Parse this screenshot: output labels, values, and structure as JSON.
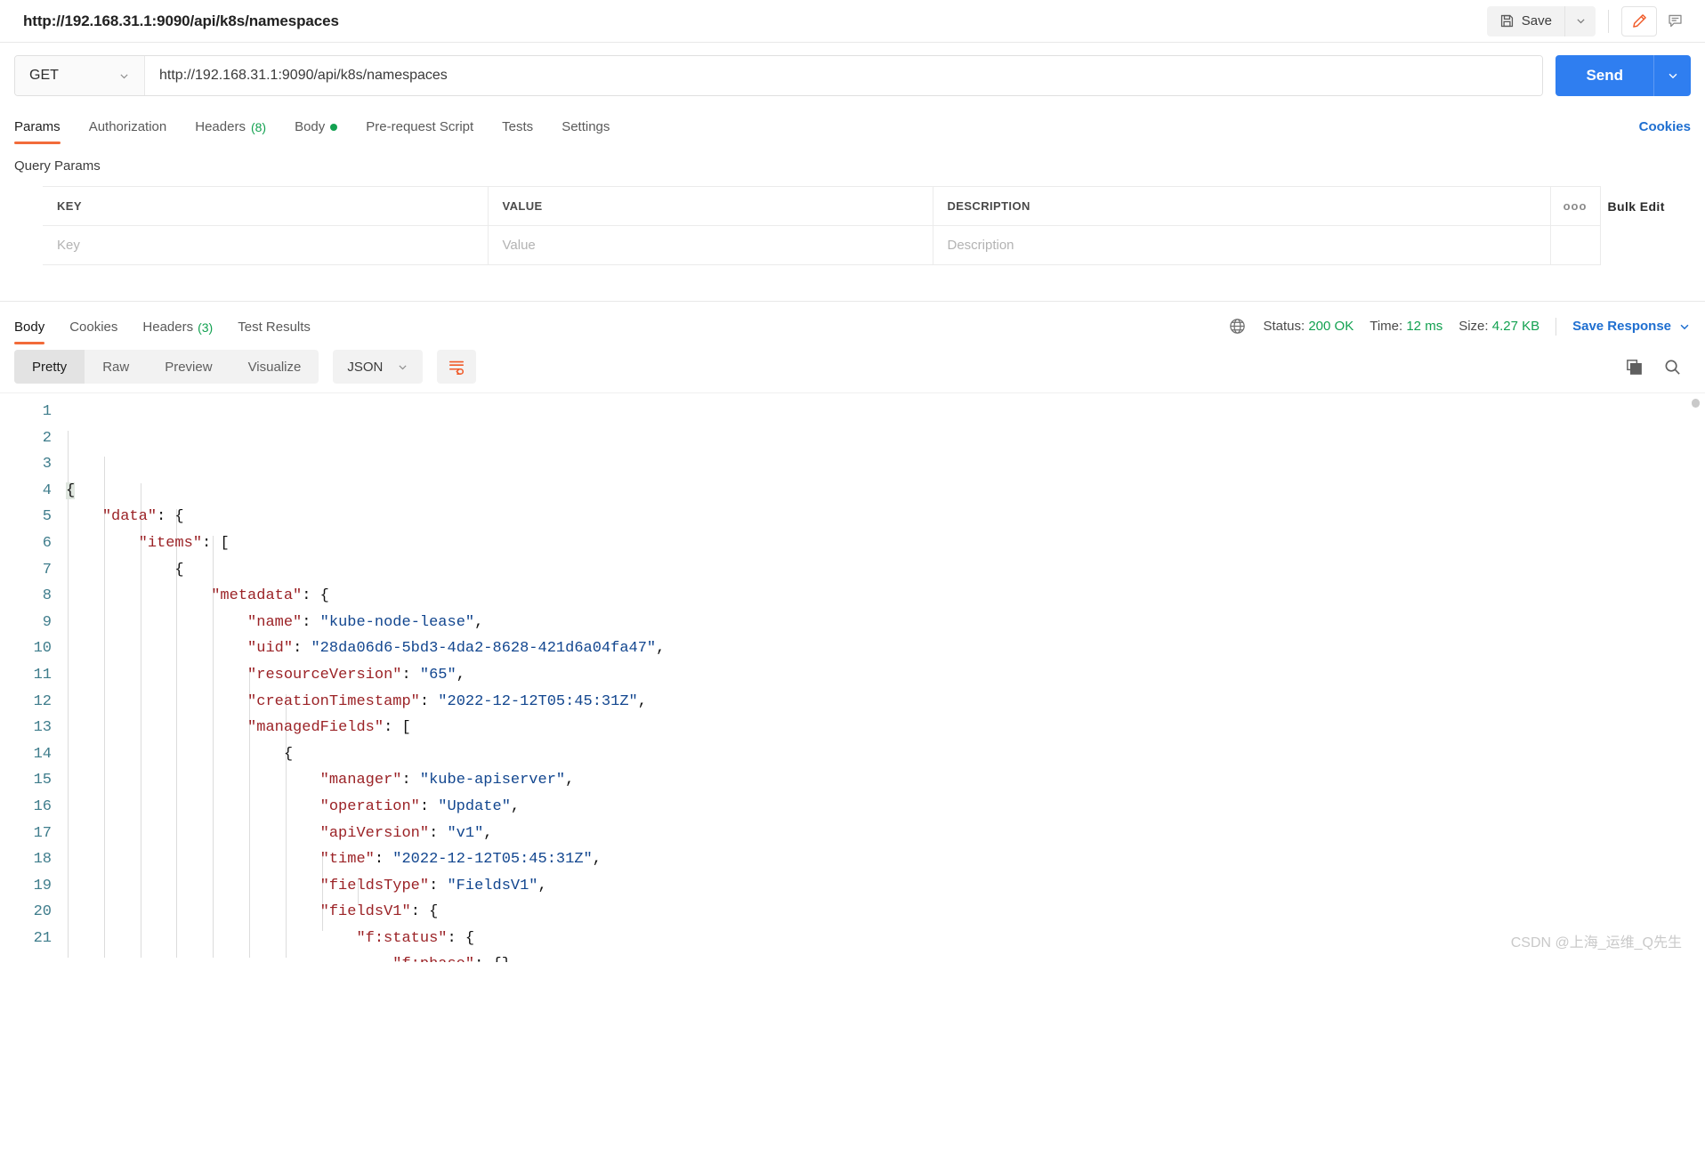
{
  "topbar": {
    "request_title": "http://192.168.31.1:9090/api/k8s/namespaces",
    "save_label": "Save",
    "save_icon": "floppy-disk-icon",
    "save_caret_icon": "chevron-down-icon",
    "edit_icon": "pencil-icon",
    "comment_icon": "comment-icon",
    "accent_color": "#f26b3a"
  },
  "url_row": {
    "method": "GET",
    "method_caret_icon": "chevron-down-icon",
    "url": "http://192.168.31.1:9090/api/k8s/namespaces",
    "send_label": "Send",
    "send_caret_icon": "chevron-down-icon",
    "send_color": "#2f7ef0"
  },
  "request_tabs": {
    "items": [
      {
        "label": "Params",
        "active": true,
        "count": "",
        "dot": false
      },
      {
        "label": "Authorization",
        "active": false,
        "count": "",
        "dot": false
      },
      {
        "label": "Headers",
        "active": false,
        "count": "(8)",
        "dot": false
      },
      {
        "label": "Body",
        "active": false,
        "count": "",
        "dot": true
      },
      {
        "label": "Pre-request Script",
        "active": false,
        "count": "",
        "dot": false
      },
      {
        "label": "Tests",
        "active": false,
        "count": "",
        "dot": false
      },
      {
        "label": "Settings",
        "active": false,
        "count": "",
        "dot": false
      }
    ],
    "cookies_label": "Cookies"
  },
  "query_params": {
    "section_label": "Query Params",
    "headers": [
      "KEY",
      "VALUE",
      "DESCRIPTION"
    ],
    "more_icon": "ellipsis-icon",
    "more_glyph": "ooo",
    "bulk_edit_label": "Bulk Edit",
    "row_placeholders": [
      "Key",
      "Value",
      "Description"
    ]
  },
  "response": {
    "tabs": [
      {
        "label": "Body",
        "active": true,
        "count": ""
      },
      {
        "label": "Cookies",
        "active": false,
        "count": ""
      },
      {
        "label": "Headers",
        "active": false,
        "count": "(3)"
      },
      {
        "label": "Test Results",
        "active": false,
        "count": ""
      }
    ],
    "globe_icon": "globe-icon",
    "status_label": "Status:",
    "status_value": "200 OK",
    "time_label": "Time:",
    "time_value": "12 ms",
    "size_label": "Size:",
    "size_value": "4.27 KB",
    "save_response_label": "Save Response",
    "save_response_caret_icon": "chevron-down-icon"
  },
  "format_bar": {
    "views": [
      {
        "label": "Pretty",
        "active": true
      },
      {
        "label": "Raw",
        "active": false
      },
      {
        "label": "Preview",
        "active": false
      },
      {
        "label": "Visualize",
        "active": false
      }
    ],
    "language": "JSON",
    "language_caret_icon": "chevron-down-icon",
    "wrap_icon": "wrap-lines-icon",
    "copy_icon": "copy-icon",
    "search_icon": "search-icon"
  },
  "code": {
    "language": "json",
    "first_line": 1,
    "last_visible_line": 21,
    "lines": [
      {
        "n": 1,
        "indent": 0,
        "segs": [
          [
            "p",
            "{"
          ]
        ],
        "highlight_brace": true
      },
      {
        "n": 2,
        "indent": 1,
        "segs": [
          [
            "k",
            "\"data\""
          ],
          [
            "p",
            ": {"
          ]
        ]
      },
      {
        "n": 3,
        "indent": 2,
        "segs": [
          [
            "k",
            "\"items\""
          ],
          [
            "p",
            ": ["
          ]
        ]
      },
      {
        "n": 4,
        "indent": 3,
        "segs": [
          [
            "p",
            "{"
          ]
        ]
      },
      {
        "n": 5,
        "indent": 4,
        "segs": [
          [
            "k",
            "\"metadata\""
          ],
          [
            "p",
            ": {"
          ]
        ]
      },
      {
        "n": 6,
        "indent": 5,
        "segs": [
          [
            "k",
            "\"name\""
          ],
          [
            "p",
            ": "
          ],
          [
            "s",
            "\"kube-node-lease\""
          ],
          [
            "p",
            ","
          ]
        ]
      },
      {
        "n": 7,
        "indent": 5,
        "segs": [
          [
            "k",
            "\"uid\""
          ],
          [
            "p",
            ": "
          ],
          [
            "s",
            "\"28da06d6-5bd3-4da2-8628-421d6a04fa47\""
          ],
          [
            "p",
            ","
          ]
        ]
      },
      {
        "n": 8,
        "indent": 5,
        "segs": [
          [
            "k",
            "\"resourceVersion\""
          ],
          [
            "p",
            ": "
          ],
          [
            "s",
            "\"65\""
          ],
          [
            "p",
            ","
          ]
        ]
      },
      {
        "n": 9,
        "indent": 5,
        "segs": [
          [
            "k",
            "\"creationTimestamp\""
          ],
          [
            "p",
            ": "
          ],
          [
            "s",
            "\"2022-12-12T05:45:31Z\""
          ],
          [
            "p",
            ","
          ]
        ]
      },
      {
        "n": 10,
        "indent": 5,
        "segs": [
          [
            "k",
            "\"managedFields\""
          ],
          [
            "p",
            ": ["
          ]
        ]
      },
      {
        "n": 11,
        "indent": 6,
        "segs": [
          [
            "p",
            "{"
          ]
        ]
      },
      {
        "n": 12,
        "indent": 7,
        "segs": [
          [
            "k",
            "\"manager\""
          ],
          [
            "p",
            ": "
          ],
          [
            "s",
            "\"kube-apiserver\""
          ],
          [
            "p",
            ","
          ]
        ]
      },
      {
        "n": 13,
        "indent": 7,
        "segs": [
          [
            "k",
            "\"operation\""
          ],
          [
            "p",
            ": "
          ],
          [
            "s",
            "\"Update\""
          ],
          [
            "p",
            ","
          ]
        ]
      },
      {
        "n": 14,
        "indent": 7,
        "segs": [
          [
            "k",
            "\"apiVersion\""
          ],
          [
            "p",
            ": "
          ],
          [
            "s",
            "\"v1\""
          ],
          [
            "p",
            ","
          ]
        ]
      },
      {
        "n": 15,
        "indent": 7,
        "segs": [
          [
            "k",
            "\"time\""
          ],
          [
            "p",
            ": "
          ],
          [
            "s",
            "\"2022-12-12T05:45:31Z\""
          ],
          [
            "p",
            ","
          ]
        ]
      },
      {
        "n": 16,
        "indent": 7,
        "segs": [
          [
            "k",
            "\"fieldsType\""
          ],
          [
            "p",
            ": "
          ],
          [
            "s",
            "\"FieldsV1\""
          ],
          [
            "p",
            ","
          ]
        ]
      },
      {
        "n": 17,
        "indent": 7,
        "segs": [
          [
            "k",
            "\"fieldsV1\""
          ],
          [
            "p",
            ": {"
          ]
        ]
      },
      {
        "n": 18,
        "indent": 8,
        "segs": [
          [
            "k",
            "\"f:status\""
          ],
          [
            "p",
            ": {"
          ]
        ]
      },
      {
        "n": 19,
        "indent": 9,
        "segs": [
          [
            "k",
            "\"f:phase\""
          ],
          [
            "p",
            ": {}"
          ]
        ]
      },
      {
        "n": 20,
        "indent": 8,
        "segs": [
          [
            "p",
            "}"
          ]
        ]
      },
      {
        "n": 21,
        "indent": 7,
        "segs": [
          [
            "p",
            "}"
          ]
        ]
      }
    ],
    "colors": {
      "key": "#9b2226",
      "string": "#12468f",
      "punct": "#111111",
      "gutter": "#3f7d8c"
    }
  },
  "watermark": "CSDN @上海_运维_Q先生"
}
